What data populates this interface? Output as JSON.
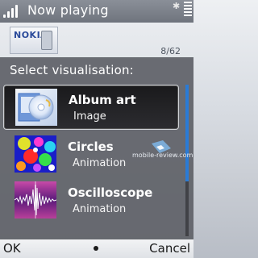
{
  "status": {
    "title": "Now playing",
    "bluetooth_icon": "bluetooth-icon",
    "battery_icon": "battery-icon",
    "signal_icon": "signal-icon"
  },
  "now_playing": {
    "art_label": "NOKIA",
    "track_counter": "8/62"
  },
  "dialog": {
    "title": "Select visualisation:",
    "items": [
      {
        "title": "Album art",
        "subtitle": "Image",
        "icon": "album-art-icon",
        "selected": true
      },
      {
        "title": "Circles",
        "subtitle": "Animation",
        "icon": "circles-icon",
        "selected": false
      },
      {
        "title": "Oscilloscope",
        "subtitle": "Animation",
        "icon": "oscilloscope-icon",
        "selected": false
      }
    ]
  },
  "watermark": "mobile-review.com",
  "softkeys": {
    "left": "OK",
    "right": "Cancel"
  },
  "colors": {
    "accent": "#2a7bd6",
    "dialog_bg": "#606268"
  }
}
